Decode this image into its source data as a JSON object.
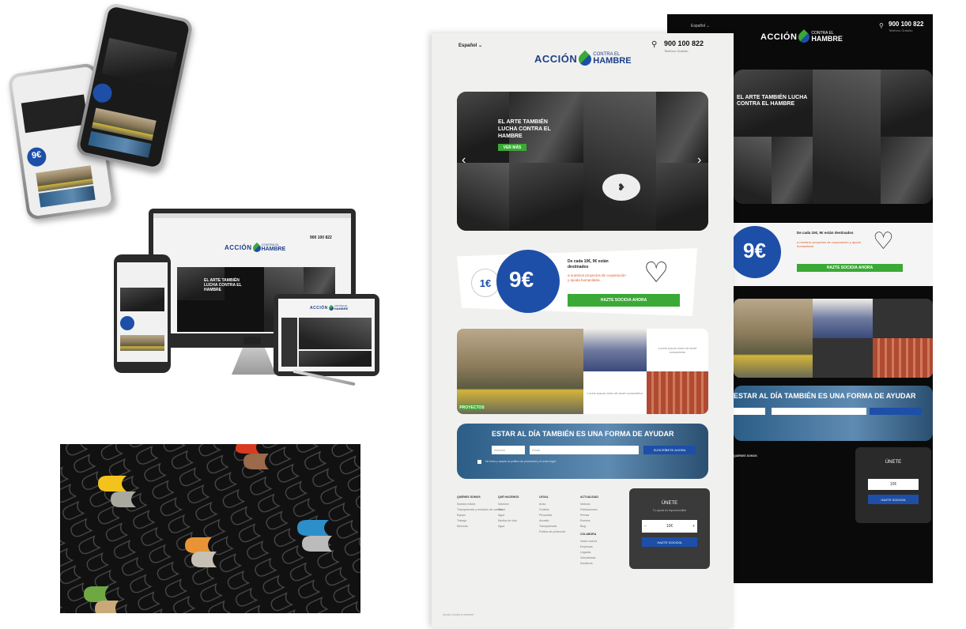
{
  "light_page": {
    "language_label": "Español",
    "phone_number": "900 100 822",
    "phone_caption": "Teléfono Gratuito",
    "logo": {
      "accion": "ACCIÓN",
      "contra": "CONTRA EL",
      "hambre": "HAMBRE"
    },
    "hero": {
      "headline": "EL ARTE TAMBIÉN LUCHA CONTRA EL HAMBRE",
      "cta_label": "VER MÁS",
      "prev_arrow": "‹",
      "next_arrow": "›"
    },
    "donation": {
      "amount_small": "1€",
      "amount_big": "9€",
      "text_bold": "De cada 10€, 9€ están destinados",
      "text_rest": "a nuestros proyectos de cooperación y ayuda humanitaria.",
      "cta_label": "HAZTE SOCIO/A AHORA"
    },
    "mosaic": {
      "tile_text_1": "Lorem ipsum dolor sit amet consectetur",
      "tile_text_2": "Lorem ipsum dolor sit amet consectetur",
      "badge_label": "PROYECTOS"
    },
    "newsletter": {
      "title": "ESTAR AL DÍA TAMBIÉN ES UNA FORMA DE AYUDAR",
      "name_placeholder": "Nombre",
      "email_placeholder": "Email",
      "button_label": "SUSCRÍBETE AHORA",
      "legal": "He leído y acepto la política de privacidad y el aviso legal."
    },
    "footer": {
      "columns": [
        {
          "heading": "QUIÉNES SOMOS",
          "items": [
            "Nuestra misión",
            "Transparencia y rendición de cuentas",
            "Equipo",
            "Trabaja",
            "Memoria"
          ]
        },
        {
          "heading": "QUÉ HACEMOS",
          "items": [
            "Nutrición",
            "Salud",
            "Agua",
            "Medios de vida",
            "Agua"
          ]
        },
        {
          "heading": "LEGAL",
          "items": [
            "Aviso",
            "Cookies",
            "Privacidad",
            "Accesib.",
            "Transparencia",
            "Política de protección"
          ]
        },
        {
          "heading": "ACTUALIDAD",
          "items": [
            "Noticias",
            "Publicaciones",
            "Prensa",
            "Eventos",
            "Blog"
          ]
        }
      ],
      "second_heading": "COLABORA",
      "second_items": [
        "Hazte socio/a",
        "Empresas",
        "Legados",
        "Voluntariado",
        "Donativos"
      ],
      "donate_box": {
        "title": "ÚNETE",
        "subtitle": "Tu ayuda es imprescindible",
        "amount": "10€",
        "button_label": "HAZTE SOCIO/A"
      },
      "copyright": "Acción Contra el Hambre"
    }
  },
  "dark_page": {
    "language_label": "Español",
    "phone_number": "900 100 822",
    "phone_caption": "Teléfono Gratuito",
    "logo": {
      "accion": "ACCIÓN",
      "contra": "CONTRA EL",
      "hambre": "HAMBRE"
    },
    "hero_headline": "EL ARTE TAMBIÉN LUCHA CONTRA EL HAMBRE",
    "donation": {
      "amount_big": "9€",
      "text_bold": "De cada 10€, 9€ están destinados",
      "text_rest": "a nuestros proyectos de cooperación y ayuda humanitaria.",
      "cta_label": "HAZTE SOCIO/A AHORA"
    },
    "newsletter_title": "ESTAR AL DÍA TAMBIÉN ES UNA FORMA DE AYUDAR",
    "donate_box": {
      "title": "ÚNETE",
      "amount": "10€",
      "button_label": "HAZTE SOCIO/A"
    }
  },
  "devices": {
    "monitor_phone_number": "900 100 822",
    "monitor_logo": {
      "accion": "ACCIÓN",
      "contra": "CONTRA EL",
      "hambre": "HAMBRE"
    },
    "monitor_headline": "EL ARTE TAMBIÉN LUCHA CONTRA EL HAMBRE",
    "tablet_logo": {
      "accion": "ACCIÓN",
      "contra": "CONTRA EL",
      "hambre": "HAMBRE"
    },
    "phone_amount": "9€"
  },
  "colors": {
    "brand_blue": "#1e3f86",
    "accent_blue": "#1d4fa8",
    "brand_green": "#3aa935",
    "light_bg": "#f0f0ef",
    "dark_bg": "#0a0a0a"
  }
}
